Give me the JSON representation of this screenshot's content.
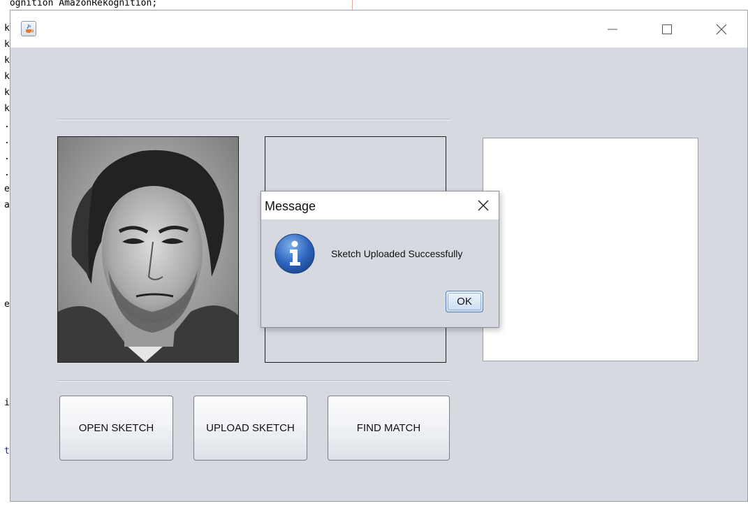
{
  "background_code": {
    "top_line": "kognition AmazonRekognition;",
    "gutter_chars": [
      "k",
      "k",
      "k",
      "k",
      "k",
      "k",
      ".",
      ".",
      ".",
      ".",
      "e",
      "a",
      "e",
      "i",
      "t"
    ]
  },
  "window": {
    "title": "",
    "controls": {
      "minimize": "minimize-icon",
      "maximize": "maximize-icon",
      "close": "close-icon"
    }
  },
  "images": {
    "sketch_photo": "sketch-portrait",
    "middle_panel": "",
    "right_panel": ""
  },
  "buttons": {
    "open_sketch": "OPEN SKETCH",
    "upload_sketch": "UPLOAD SKETCH",
    "find_match": "FIND MATCH"
  },
  "dialog": {
    "title": "Message",
    "message": "Sketch Uploaded Successfully",
    "ok_label": "OK",
    "icon": "info-icon"
  },
  "colors": {
    "window_bg": "#d6d9e0",
    "info_blue": "#2a5fb0",
    "ok_border": "#5b7fa8"
  }
}
